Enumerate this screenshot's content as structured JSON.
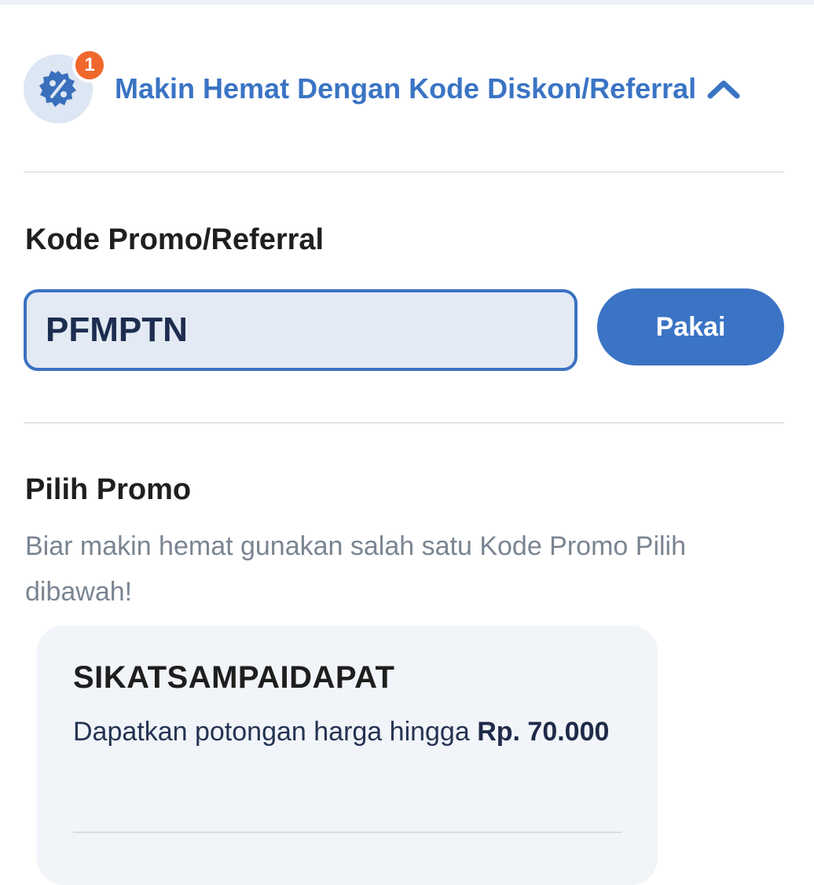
{
  "header": {
    "badge_count": "1",
    "title": "Makin Hemat Dengan Kode Diskon/Referral",
    "accent_color": "#3a74c4",
    "badge_color": "#f0672c"
  },
  "code_entry": {
    "label": "Kode Promo/Referral",
    "value": "PFMPTN",
    "button_label": "Pakai"
  },
  "promo_list": {
    "title": "Pilih Promo",
    "subtitle": "Biar makin hemat gunakan salah satu Kode Promo Pilih dibawah!",
    "items": [
      {
        "code": "SIKATSAMPAIDAPAT",
        "description_prefix": "Dapatkan potongan harga hingga ",
        "amount": "Rp. 70.000"
      }
    ]
  }
}
